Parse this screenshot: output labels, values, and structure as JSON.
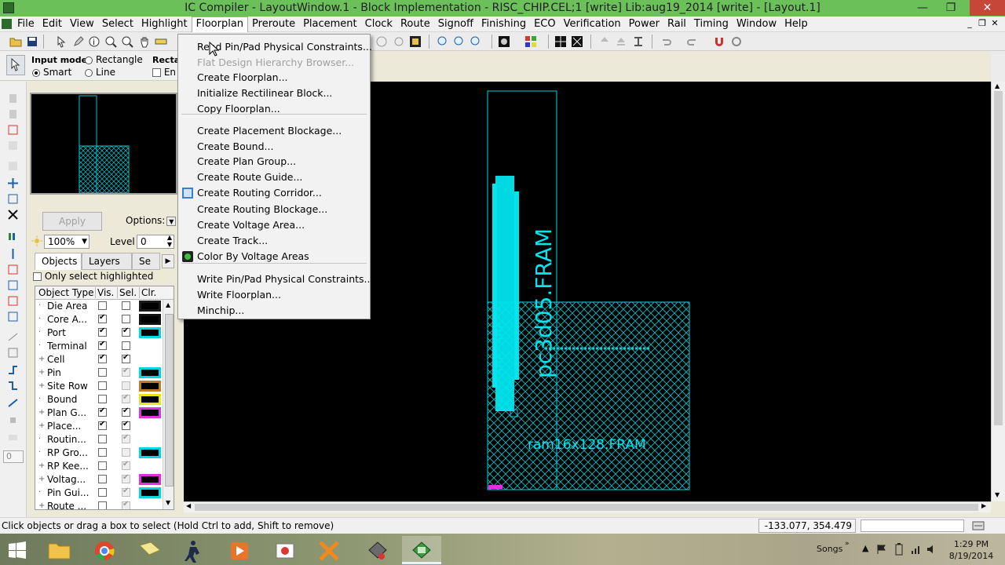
{
  "window": {
    "title": "IC Compiler - LayoutWindow.1 - Block Implementation - RISC_CHIP.CEL;1 [write]    Lib:aug19_2014 [write] - [Layout.1]",
    "controls": {
      "minimize": "—",
      "restore": "❐",
      "close": "✕"
    }
  },
  "menubar": {
    "items": [
      "File",
      "Edit",
      "View",
      "Select",
      "Highlight",
      "Floorplan",
      "Preroute",
      "Placement",
      "Clock",
      "Route",
      "Signoff",
      "Finishing",
      "ECO",
      "Verification",
      "Power",
      "Rail",
      "Timing",
      "Window",
      "Help"
    ],
    "active": "Floorplan",
    "mdi_controls": [
      "_",
      "❐",
      "✕"
    ]
  },
  "input_mode": {
    "label": "Input mode",
    "options": [
      "Rectangle",
      "Smart",
      "Line"
    ],
    "selected": "Smart",
    "rect_label": "Recta",
    "en_label": "En"
  },
  "panel": {
    "apply_label": "Apply",
    "options_label": "Options:",
    "zoom_value": "100%",
    "level_label": "Level",
    "level_value": "0",
    "tabs": [
      "Objects",
      "Layers",
      "Se"
    ],
    "only_selected_label": "Only select highlighted",
    "columns": [
      "Object Type",
      "Vis.",
      "Sel.",
      "Clr."
    ],
    "rows": [
      {
        "name": "Die Area",
        "expandable": false,
        "vis": false,
        "sel": false,
        "sel_disabled": false,
        "color": "#1a1a1a"
      },
      {
        "name": "Core A...",
        "expandable": false,
        "vis": true,
        "sel": false,
        "sel_disabled": false,
        "color": "#111111"
      },
      {
        "name": "Port",
        "expandable": false,
        "vis": true,
        "sel": true,
        "sel_disabled": false,
        "color": "#00d5e0"
      },
      {
        "name": "Terminal",
        "expandable": false,
        "vis": true,
        "sel": false,
        "sel_disabled": false,
        "color": ""
      },
      {
        "name": "Cell",
        "expandable": true,
        "vis": true,
        "sel": true,
        "sel_disabled": false,
        "color": ""
      },
      {
        "name": "Pin",
        "expandable": true,
        "vis": false,
        "sel": true,
        "sel_disabled": true,
        "color": "#00d5e0"
      },
      {
        "name": "Site Row",
        "expandable": true,
        "vis": false,
        "sel": false,
        "sel_disabled": true,
        "color": "#c07a2c"
      },
      {
        "name": "Bound",
        "expandable": false,
        "vis": false,
        "sel": true,
        "sel_disabled": true,
        "color": "#e5e51a"
      },
      {
        "name": "Plan G...",
        "expandable": true,
        "vis": true,
        "sel": true,
        "sel_disabled": false,
        "color": "#e030e0"
      },
      {
        "name": "Place...",
        "expandable": true,
        "vis": true,
        "sel": true,
        "sel_disabled": false,
        "color": ""
      },
      {
        "name": "Routin...",
        "expandable": false,
        "vis": false,
        "sel": true,
        "sel_disabled": true,
        "color": ""
      },
      {
        "name": "RP Gro...",
        "expandable": false,
        "vis": false,
        "sel": false,
        "sel_disabled": true,
        "color": "#00d5e0"
      },
      {
        "name": "RP Kee...",
        "expandable": true,
        "vis": false,
        "sel": true,
        "sel_disabled": true,
        "color": ""
      },
      {
        "name": "Voltag...",
        "expandable": true,
        "vis": false,
        "sel": true,
        "sel_disabled": true,
        "color": "#e030e0"
      },
      {
        "name": "Pin Gui...",
        "expandable": false,
        "vis": false,
        "sel": true,
        "sel_disabled": true,
        "color": "#00d5e0"
      },
      {
        "name": "Route ...",
        "expandable": true,
        "vis": false,
        "sel": true,
        "sel_disabled": true,
        "color": ""
      }
    ]
  },
  "floorplan_menu": {
    "items": [
      {
        "label": "Read Pin/Pad Physical Constraints...",
        "disabled": false,
        "icon": ""
      },
      {
        "label": "Flat Design Hierarchy Browser...",
        "disabled": true,
        "icon": ""
      },
      {
        "label": "Create Floorplan...",
        "disabled": false,
        "icon": ""
      },
      {
        "label": "Initialize Rectilinear Block...",
        "disabled": false,
        "icon": ""
      },
      {
        "label": "Copy Floorplan...",
        "disabled": false,
        "icon": ""
      },
      {
        "label": "Create Placement Blockage...",
        "disabled": false,
        "icon": ""
      },
      {
        "label": "Create Bound...",
        "disabled": false,
        "icon": ""
      },
      {
        "label": "Create Plan Group...",
        "disabled": false,
        "icon": ""
      },
      {
        "label": "Create Route Guide...",
        "disabled": false,
        "icon": ""
      },
      {
        "label": "Create Routing Corridor...",
        "disabled": false,
        "icon": "routing-corridor-icon"
      },
      {
        "label": "Create Routing Blockage...",
        "disabled": false,
        "icon": ""
      },
      {
        "label": "Create Voltage Area...",
        "disabled": false,
        "icon": ""
      },
      {
        "label": "Create Track...",
        "disabled": false,
        "icon": ""
      },
      {
        "label": "Color By Voltage Areas",
        "disabled": false,
        "icon": "color-voltage-icon"
      },
      {
        "label": "Write Pin/Pad Physical Constraints...",
        "disabled": false,
        "icon": ""
      },
      {
        "label": "Write Floorplan...",
        "disabled": false,
        "icon": ""
      },
      {
        "label": "Minchip...",
        "disabled": false,
        "icon": ""
      }
    ]
  },
  "canvas": {
    "labels": [
      "pc3d05.FRAM",
      "ram16x128.FRAM"
    ],
    "accent": "#00e5ee"
  },
  "statusbar": {
    "message": "Click objects or drag a box to select (Hold Ctrl to add, Shift to remove)",
    "coords": "-133.077, 354.479"
  },
  "taskbar": {
    "songs_label": "Songs",
    "time": "1:29 PM",
    "date": "8/19/2014"
  }
}
